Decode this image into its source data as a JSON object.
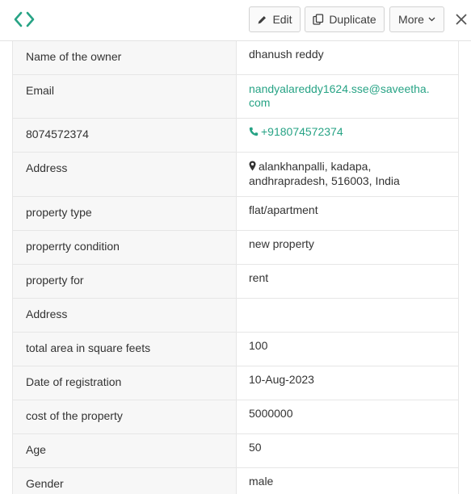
{
  "toolbar": {
    "edit_label": "Edit",
    "duplicate_label": "Duplicate",
    "more_label": "More"
  },
  "colors": {
    "accent": "#27a385",
    "label_bg": "#f7f7f7",
    "border": "#e6e6e6"
  },
  "rows": [
    {
      "label": "Name of the owner",
      "value": "dhanush reddy"
    },
    {
      "label": "Email",
      "value": "nandyalareddy1624.sse@saveetha.com"
    },
    {
      "label": "8074572374",
      "value": "+918074572374"
    },
    {
      "label": "Address",
      "value": "alankhanpalli, kadapa, andhrapradesh, 516003, India"
    },
    {
      "label": "property type",
      "value": "flat/apartment"
    },
    {
      "label": "properrty condition",
      "value": "new property"
    },
    {
      "label": "property for",
      "value": "rent"
    },
    {
      "label": "Address",
      "value": ""
    },
    {
      "label": "total area in square feets",
      "value": "100"
    },
    {
      "label": "Date of registration",
      "value": "10-Aug-2023"
    },
    {
      "label": "cost of the property",
      "value": "5000000"
    },
    {
      "label": "Age",
      "value": "50"
    },
    {
      "label": "Gender",
      "value": "male"
    }
  ],
  "icons": {
    "logo": "code-brackets-icon",
    "edit": "pencil-icon",
    "duplicate": "duplicate-icon",
    "more": "chevron-down-icon",
    "close": "close-icon",
    "phone": "phone-icon",
    "address": "map-pin-icon"
  }
}
